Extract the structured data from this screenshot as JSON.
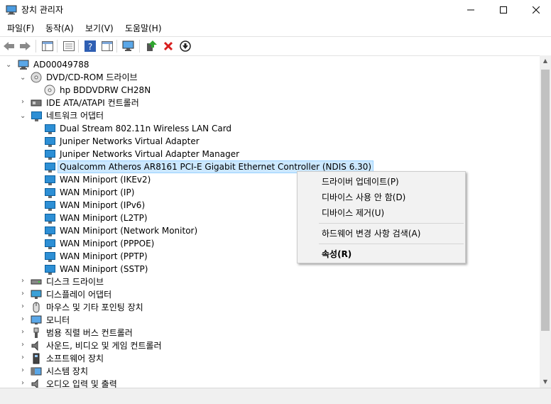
{
  "window": {
    "title": "장치 관리자",
    "minimize": "—",
    "maximize": "☐",
    "close": "✕"
  },
  "menu": [
    "파일(F)",
    "동작(A)",
    "보기(V)",
    "도움말(H)"
  ],
  "tree": {
    "root": "AD00049788",
    "dvd": {
      "label": "DVD/CD-ROM 드라이브",
      "children": [
        "hp BDDVDRW CH28N"
      ]
    },
    "ide": {
      "label": "IDE ATA/ATAPI 컨트롤러"
    },
    "network": {
      "label": "네트워크 어댑터",
      "children": [
        "Dual Stream 802.11n Wireless LAN Card",
        "Juniper Networks Virtual Adapter",
        "Juniper Networks Virtual Adapter Manager",
        "Qualcomm Atheros AR8161 PCI-E Gigabit Ethernet Controller (NDIS 6.30)",
        "WAN Miniport (IKEv2)",
        "WAN Miniport (IP)",
        "WAN Miniport (IPv6)",
        "WAN Miniport (L2TP)",
        "WAN Miniport (Network Monitor)",
        "WAN Miniport (PPPOE)",
        "WAN Miniport (PPTP)",
        "WAN Miniport (SSTP)"
      ]
    },
    "others": [
      "디스크 드라이브",
      "디스플레이 어댑터",
      "마우스 및 기타 포인팅 장치",
      "모니터",
      "범용 직렬 버스 컨트롤러",
      "사운드, 비디오 및 게임 컨트롤러",
      "소프트웨어 장치",
      "시스템 장치",
      "오디오 입력 및 출력"
    ]
  },
  "context_menu": {
    "update_driver": "드라이버 업데이트(P)",
    "disable_device": "디바이스 사용 안 함(D)",
    "uninstall_device": "디바이스 제거(U)",
    "scan_hardware": "하드웨어 변경 사항 검색(A)",
    "properties": "속성(R)"
  }
}
